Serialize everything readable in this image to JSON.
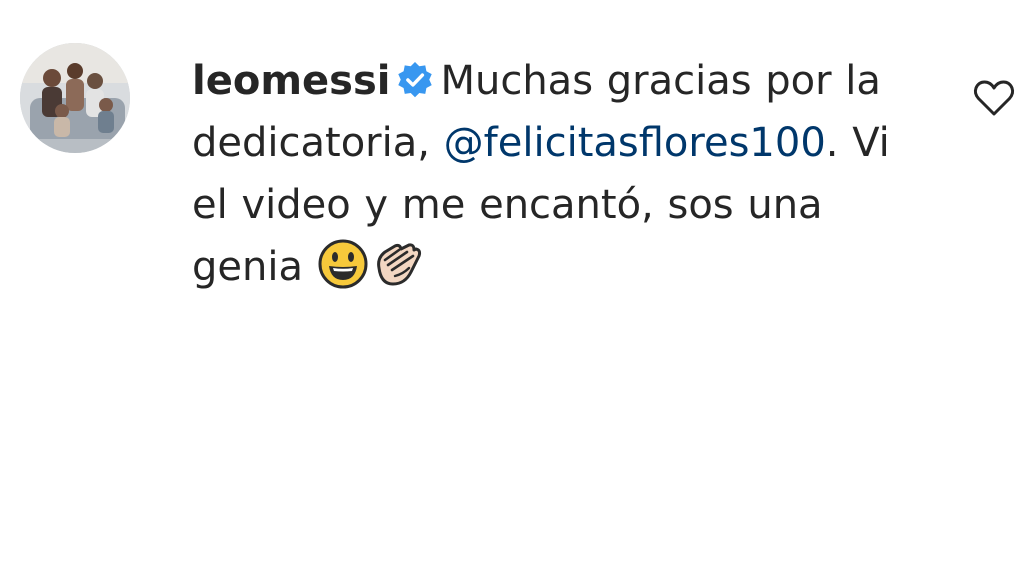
{
  "comment": {
    "username": "leomessi",
    "verified_icon": "verified-badge-icon",
    "text_before_mention": "Muchas gracias por la dedicatoria, ",
    "mention": "@felicitasflores100",
    "text_after_mention": ". Vi el video y me encantó, sos una genia ",
    "emojis": [
      "smiling-face-emoji",
      "clapping-hands-emoji"
    ],
    "like_icon": "heart-outline-icon"
  },
  "colors": {
    "text": "#262626",
    "mention": "#00376b",
    "verified": "#3897f0",
    "background": "#ffffff"
  }
}
